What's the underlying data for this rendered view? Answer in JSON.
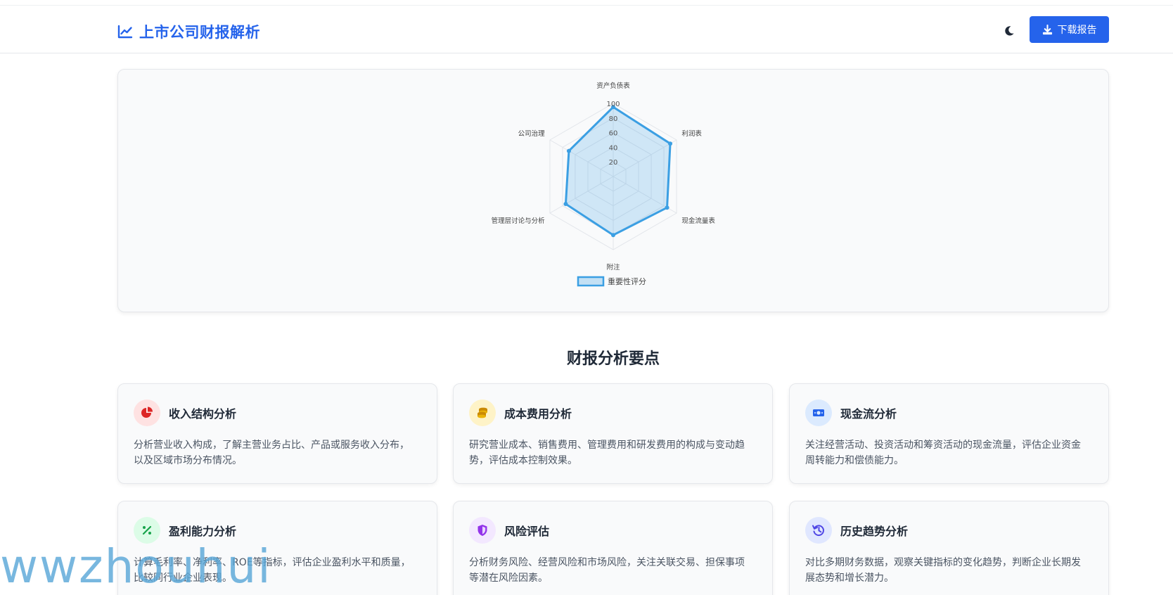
{
  "header": {
    "title": "上市公司财报解析",
    "download_label": "下载报告",
    "accent": "#2563eb"
  },
  "chart_data": {
    "type": "radar",
    "categories": [
      "资产负债表",
      "利润表",
      "现金流量表",
      "附注",
      "管理层讨论与分析",
      "公司治理"
    ],
    "series": [
      {
        "name": "重要性评分",
        "values": [
          95,
          90,
          85,
          80,
          75,
          70
        ]
      }
    ],
    "rlim": [
      0,
      100
    ],
    "ticks": [
      20,
      40,
      60,
      80,
      100
    ],
    "legend": "bottom",
    "color": "#3b9fe3"
  },
  "section": {
    "title": "财报分析要点"
  },
  "cards": [
    {
      "title": "收入结构分析",
      "desc": "分析营业收入构成，了解主营业务占比、产品或服务收入分布，以及区域市场分布情况。",
      "icon": "pie-chart-icon",
      "icon_color": "#dc2626",
      "icon_bg": "#fee2e2"
    },
    {
      "title": "成本费用分析",
      "desc": "研究营业成本、销售费用、管理费用和研发费用的构成与变动趋势，评估成本控制效果。",
      "icon": "coins-icon",
      "icon_color": "#ca8a04",
      "icon_bg": "#fef3c7"
    },
    {
      "title": "现金流分析",
      "desc": "关注经营活动、投资活动和筹资活动的现金流量，评估企业资金周转能力和偿债能力。",
      "icon": "money-bill-icon",
      "icon_color": "#2563eb",
      "icon_bg": "#dbeafe"
    },
    {
      "title": "盈利能力分析",
      "desc": "计算毛利率、净利率、ROE等指标，评估企业盈利水平和质量，比较同行业企业表现。",
      "icon": "percent-icon",
      "icon_color": "#16a34a",
      "icon_bg": "#dcfce7"
    },
    {
      "title": "风险评估",
      "desc": "分析财务风险、经营风险和市场风险，关注关联交易、担保事项等潜在风险因素。",
      "icon": "shield-icon",
      "icon_color": "#9333ea",
      "icon_bg": "#f3e8ff"
    },
    {
      "title": "历史趋势分析",
      "desc": "对比多期财务数据，观察关键指标的变化趋势，判断企业长期发展态势和增长潜力。",
      "icon": "history-icon",
      "icon_color": "#4f46e5",
      "icon_bg": "#e0e7ff"
    }
  ],
  "watermark": "wwzhouhui"
}
